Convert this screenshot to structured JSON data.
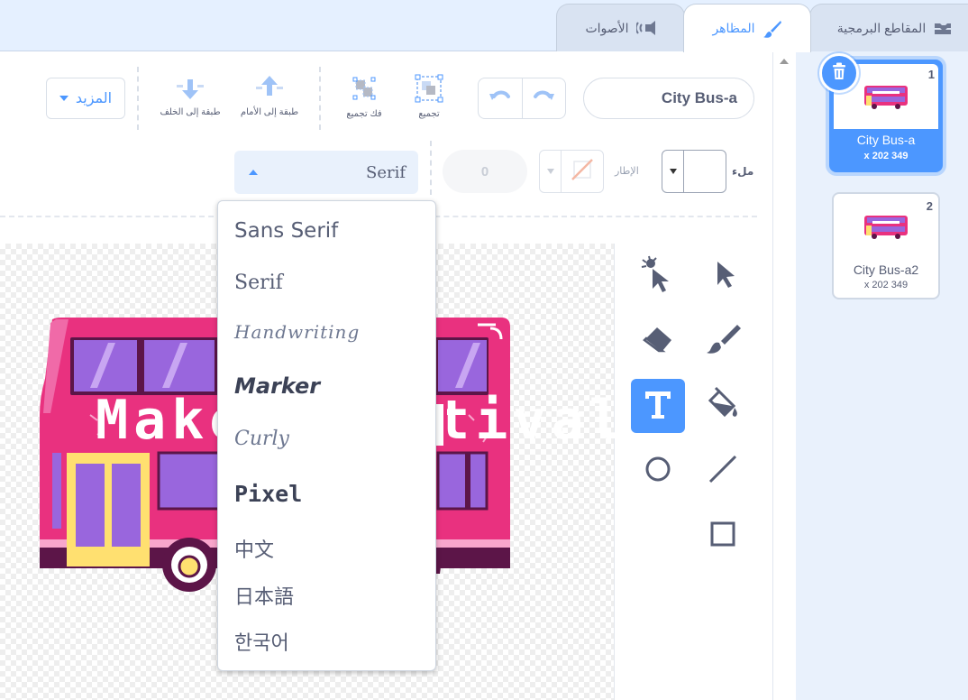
{
  "tabs": [
    {
      "label": "المقاطع البرمجية",
      "icon": "code-icon"
    },
    {
      "label": "المظاهر",
      "icon": "brush-icon",
      "active": true
    },
    {
      "label": "الأصوات",
      "icon": "speaker-icon"
    }
  ],
  "editor": {
    "costume_name": "City Bus-a",
    "group_label": "تجميع",
    "ungroup_label": "فك تجميع",
    "forward_label": "طبقة إلى الأمام",
    "backward_label": "طبقة إلى الخلف",
    "more_label": "المزيد",
    "fill_label": "ملء",
    "outline_label": "الإطار",
    "outline_width": "0",
    "font_selected": "Serif"
  },
  "font_menu": {
    "items": [
      "Sans Serif",
      "Serif",
      "Handwriting",
      "Marker",
      "Curly",
      "Pixel",
      "中文",
      "日本語",
      "한국어"
    ]
  },
  "canvas": {
    "bus_text": "Maker Festival"
  },
  "costumes": [
    {
      "index": "1",
      "name": "City Bus-a",
      "size": "x 202 349",
      "selected": true
    },
    {
      "index": "2",
      "name": "City Bus-a2",
      "size": "x 202 349",
      "selected": false
    }
  ],
  "colors": {
    "accent": "#4c97ff",
    "text": "#575e75",
    "bus_pink": "#e9317f",
    "bus_dark": "#5c1548",
    "window_purple": "#9966dd",
    "door_yellow": "#ffe070"
  }
}
